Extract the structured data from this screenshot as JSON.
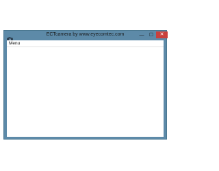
{
  "window": {
    "title": "ECTcamera by www.eyecomtec.com",
    "app_icon": "camera-icon",
    "buttons": {
      "minimize": "—",
      "maximize": "☐",
      "close": "✕"
    }
  },
  "menubar": {
    "items": [
      {
        "label": "Menu"
      }
    ]
  },
  "colors": {
    "frame": "#5d8aa8",
    "close_button": "#c9403c",
    "client": "#ffffff"
  }
}
